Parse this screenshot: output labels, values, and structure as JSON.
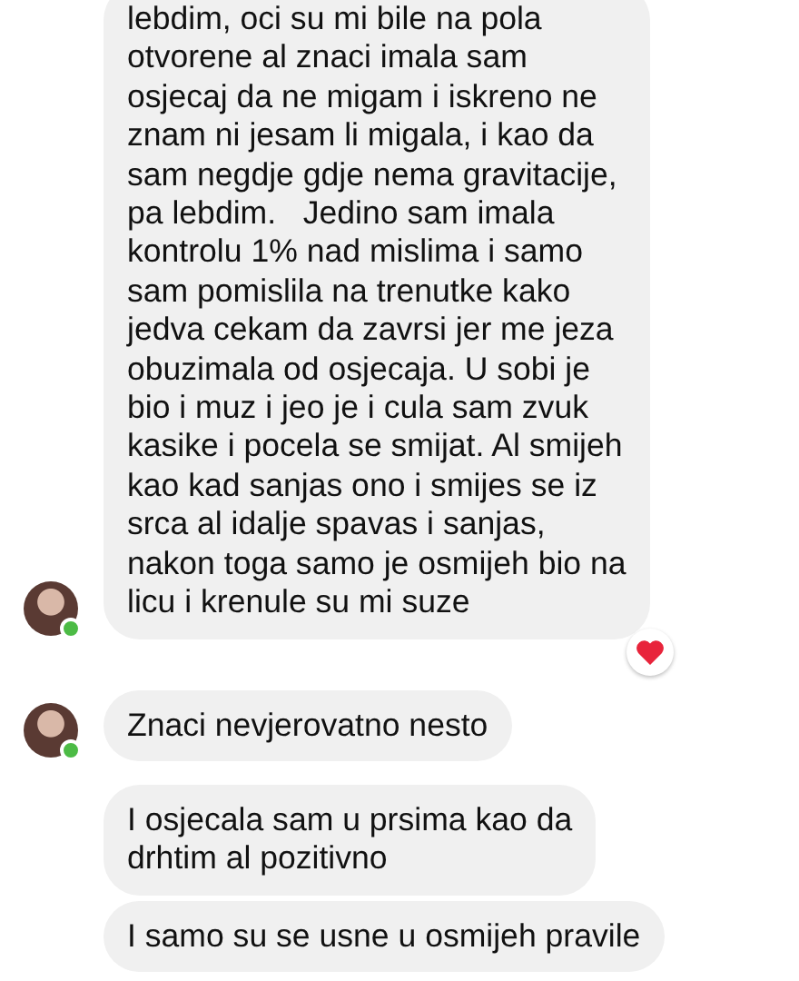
{
  "messages": [
    {
      "text": "lebdim, oci su mi bile na pola\notvorene al znaci imala sam\nosjecaj da ne migam i iskreno ne\nznam ni jesam li migala, i kao da\nsam negdje gdje nema gravitacije,\npa lebdim.   Jedino sam imala\nkontrolu 1% nad mislima i samo\nsam pomislila na trenutke kako\njedva cekam da zavrsi jer me jeza\nobuzimala od osjecaja. U sobi je\nbio i muz i jeo je i cula sam zvuk\nkasike i pocela se smijat. Al smijeh\nkao kad sanjas ono i smijes se iz\nsrca al idalje spavas i sanjas,\nnakon toga samo je osmijeh bio na\nlicu i krenule su mi suze",
      "show_avatar": true,
      "online": true,
      "reacted": true
    },
    {
      "text": "Znaci nevjerovatno nesto",
      "show_avatar": true,
      "online": true,
      "reacted": false
    },
    {
      "text": "I osjecala sam u prsima kao da\ndrhtim al pozitivno",
      "show_avatar": false,
      "online": false,
      "reacted": false
    },
    {
      "text": "I samo su se usne u osmijeh pravile",
      "show_avatar": false,
      "online": false,
      "reacted": false
    }
  ]
}
